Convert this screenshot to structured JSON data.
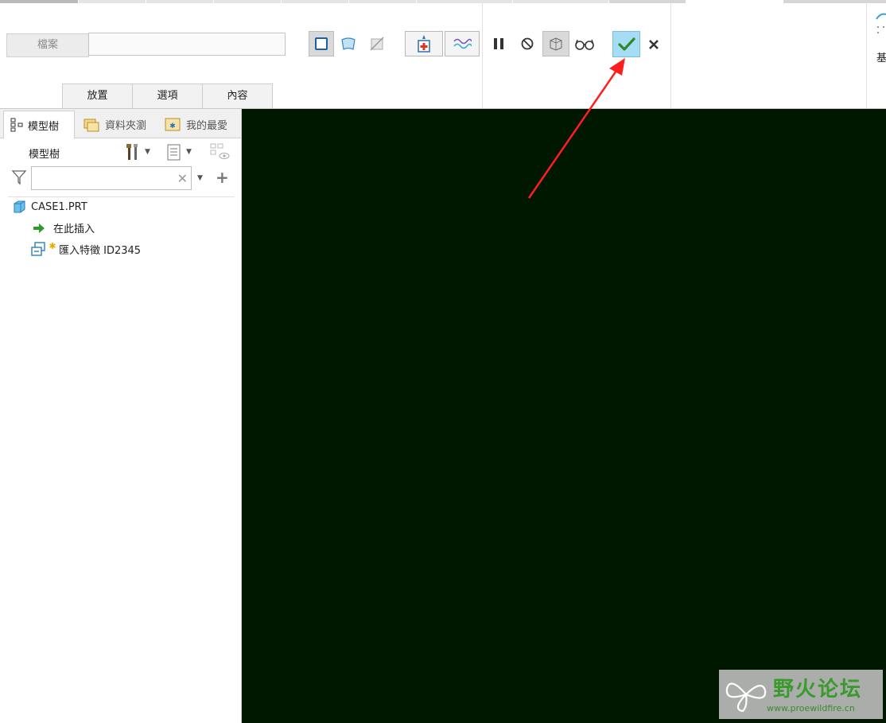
{
  "ribbon": {
    "file_label": "檔案",
    "file_value": "",
    "tabs": [
      {
        "label": "放置"
      },
      {
        "label": "選項"
      },
      {
        "label": "內容"
      }
    ],
    "side_label": "基"
  },
  "panel": {
    "tabs": [
      {
        "label": "模型樹"
      },
      {
        "label": "資料夾瀏"
      },
      {
        "label": "我的最愛"
      }
    ],
    "tree_header": "模型樹",
    "search_value": "",
    "tree": {
      "root": "CASE1.PRT",
      "insert_here": "在此插入",
      "feature": "匯入特徵 ID2345"
    }
  },
  "watermark": {
    "title": "野火论坛",
    "url": "www.proewildfire.cn"
  },
  "colors": {
    "viewport_bg": "#001700",
    "ok_highlight": "#a6dcf4",
    "annotation_arrow": "#ff1e1e"
  }
}
